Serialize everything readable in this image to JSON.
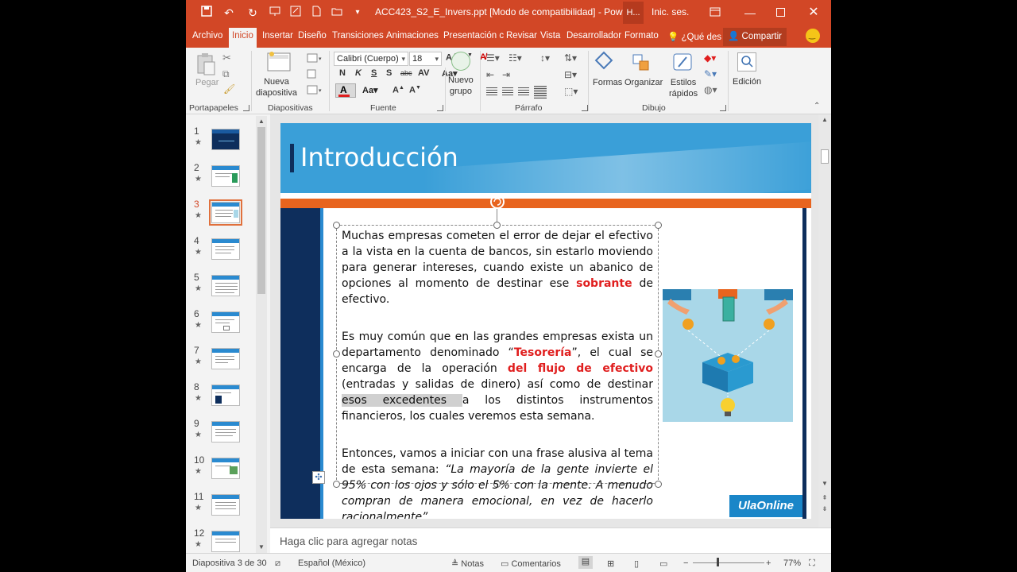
{
  "window": {
    "doc_title": "ACC423_S2_E_Invers.ppt [Modo de compatibilidad] - Power...",
    "h_button": "H...",
    "signin": "Inic. ses."
  },
  "tabs": [
    {
      "label": "Archivo"
    },
    {
      "label": "Inicio"
    },
    {
      "label": "Insertar"
    },
    {
      "label": "Diseño"
    },
    {
      "label": "Transiciones"
    },
    {
      "label": "Animaciones"
    },
    {
      "label": "Presentación c"
    },
    {
      "label": "Revisar"
    },
    {
      "label": "Vista"
    },
    {
      "label": "Desarrollador"
    },
    {
      "label": "Formato"
    },
    {
      "label": "¿Qué des"
    }
  ],
  "share_label": "Compartir",
  "ribbon": {
    "groups": {
      "portapapeles": "Portapapeles",
      "diapositivas": "Diapositivas",
      "fuente": "Fuente",
      "parrafo": "Párrafo",
      "dibujo": "Dibujo"
    },
    "pegar": "Pegar",
    "nueva_diapositiva": "Nueva\ndiapositiva",
    "font_name": "Calibri (Cuerpo)",
    "font_size": "18",
    "nuevo_grupo": "Nuevo\ngrupo",
    "formas": "Formas",
    "organizar": "Organizar",
    "estilos_rapidos": "Estilos\nrápidos",
    "edicion": "Edición"
  },
  "thumbnails": [
    {
      "num": "1"
    },
    {
      "num": "2"
    },
    {
      "num": "3"
    },
    {
      "num": "4"
    },
    {
      "num": "5"
    },
    {
      "num": "6"
    },
    {
      "num": "7"
    },
    {
      "num": "8"
    },
    {
      "num": "9"
    },
    {
      "num": "10"
    },
    {
      "num": "11"
    },
    {
      "num": "12"
    }
  ],
  "selected_slide": 3,
  "slide": {
    "title": "Introducción",
    "p1_a": "Muchas empresas cometen el error de dejar el efectivo a la vista en la cuenta de bancos, sin estarlo moviendo para generar intereses, cuando existe un abanico de opciones al momento de destinar ese ",
    "p1_red": "sobrante",
    "p1_b": " de efectivo.",
    "p2_a": "Es muy común que en las grandes empresas exista un departamento denominado “",
    "p2_red1": "Tesorería",
    "p2_b": "”, el cual se encarga de la operación ",
    "p2_red2": "del flujo de efectivo",
    "p2_c": " (entradas y salidas de dinero) así como de destinar ",
    "p2_hl": "esos excedentes ",
    "p2_d": "a los distintos instrumentos financieros, los cuales veremos esta semana.",
    "p3_a": "Entonces, vamos a iniciar con una frase alusiva al tema de esta semana: ",
    "p3_it": "“La mayoría de la gente invierte el 95% con los ojos y sólo el 5% con la mente. A menudo compran de manera emocional, en vez de hacerlo racionalmente”.",
    "logo": "UlaOnline"
  },
  "notes_placeholder": "Haga clic para agregar notas",
  "status": {
    "slide_pos": "Diapositiva 3 de 30",
    "language": "Español (México)",
    "notas": "Notas",
    "comentarios": "Comentarios",
    "zoom": "77%"
  },
  "colors": {
    "accent": "#d24726",
    "slide_blue": "#3a9fd8",
    "slide_navy": "#0e2e5c",
    "slide_orange": "#e8641e",
    "highlight_red": "#e01e1e"
  }
}
